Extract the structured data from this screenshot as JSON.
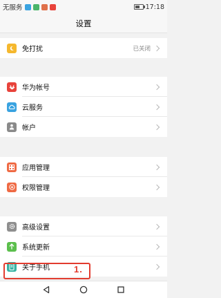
{
  "status_bar": {
    "carrier": "无服务",
    "time": "17:18",
    "battery_level": 0.6,
    "notification_icons": [
      "message-icon",
      "app-icon",
      "gallery-icon",
      "app-icon"
    ]
  },
  "header": {
    "title": "设置"
  },
  "groups": [
    {
      "items": [
        {
          "label": "免打扰",
          "value": "已关闭",
          "icon": "moon-icon",
          "color": "#f5b82e"
        }
      ]
    },
    {
      "items": [
        {
          "label": "华为帐号",
          "icon": "huawei-icon",
          "color": "#e8433b"
        },
        {
          "label": "云服务",
          "icon": "cloud-icon",
          "color": "#3aa3e0"
        },
        {
          "label": "帐户",
          "icon": "person-icon",
          "color": "#8a8a8a"
        }
      ]
    },
    {
      "items": [
        {
          "label": "应用管理",
          "icon": "apps-icon",
          "color": "#ef6a44"
        },
        {
          "label": "权限管理",
          "icon": "permission-icon",
          "color": "#ef6a44"
        }
      ]
    },
    {
      "items": [
        {
          "label": "高级设置",
          "icon": "gear-icon",
          "color": "#8f8f8f"
        },
        {
          "label": "系统更新",
          "icon": "update-icon",
          "color": "#5cbf4d"
        },
        {
          "label": "关于手机",
          "icon": "phone-info-icon",
          "color": "#37b3a4"
        }
      ]
    }
  ],
  "annotation": {
    "text": "1."
  },
  "colors": {
    "highlight": "#e23b2e"
  },
  "nav_bar": {
    "buttons": [
      "back-icon",
      "home-icon",
      "recents-icon"
    ]
  }
}
